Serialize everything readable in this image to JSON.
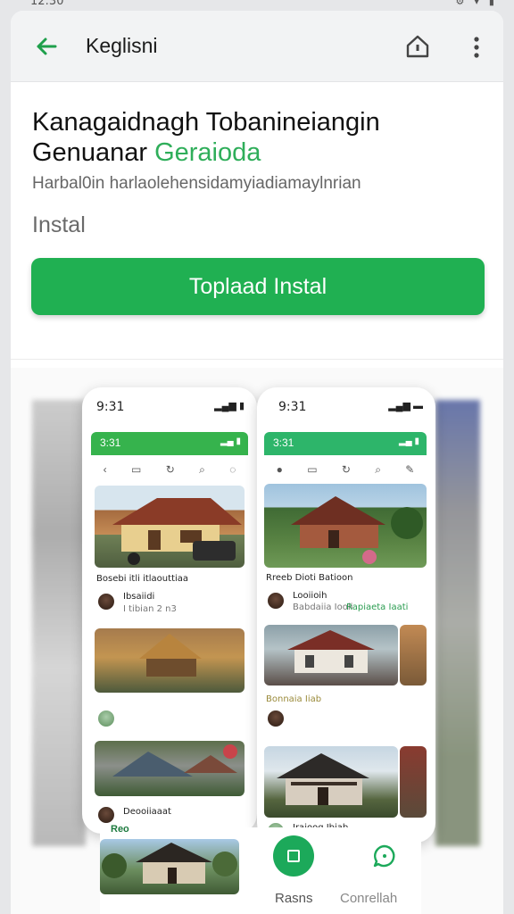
{
  "status_bar": {
    "time": "12:30",
    "icons": [
      "settings-icon",
      "wifi-icon",
      "battery-icon"
    ]
  },
  "appbar": {
    "title": "Keglisni",
    "back_icon": "back-arrow-icon",
    "home_icon": "home-icon",
    "more_icon": "more-vertical-icon"
  },
  "app": {
    "name_line1": "Kanagaidnagh Tobanineiangin",
    "name_line2_dark": "Genuanar",
    "name_line2_green": "Geraioda",
    "subtitle": "Harbal0in harlaolehensidamyiadiamaylnrian",
    "instal_label": "Instal",
    "install_button": "Toplaad Instal"
  },
  "screenshots": [
    {
      "status_time": "9:31",
      "bar_time": "3:31",
      "caption1": "Bosebi itli itlaouttiaa",
      "user1": "Ibsaiidi",
      "meta1": "I tibian 2  n3",
      "user2": "Deooiiaaat",
      "meta2": "Rao"
    },
    {
      "status_time": "9:31",
      "bar_time": "3:31",
      "caption1": "Rreeb Dioti Batioon",
      "user1": "Looiioih",
      "meta1": "Babdaiia Iooli",
      "green1": "Rapiaeta Iaati",
      "meta2": "Bonnaia Iiab",
      "user2": "Iraioog Ibiab",
      "meta3": "Ioioabioo"
    }
  ],
  "bottom_nav": {
    "card_label": "Reo",
    "primary_label": "Rasns",
    "secondary_label": "Conrellah",
    "primary_icon": "square-icon",
    "secondary_icon": "chat-bubble-icon"
  },
  "colors": {
    "accent": "#20b052",
    "accent_dark": "#1ca95a",
    "background": "#e6e7e9"
  }
}
